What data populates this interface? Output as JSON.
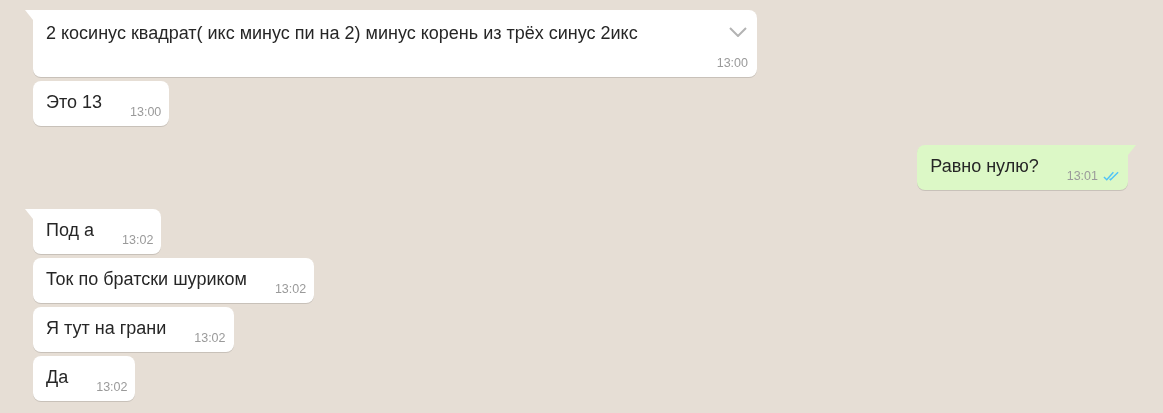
{
  "messages": [
    {
      "outgoing": false,
      "tail": true,
      "text": "2 косинус квадрат( икс минус пи на 2) минус корень из трёх синус 2икс",
      "time": "13:00",
      "time_below": true,
      "show_menu": true
    },
    {
      "outgoing": false,
      "tail": false,
      "text": "Это 13",
      "time": "13:00",
      "time_below": false,
      "show_menu": false
    },
    {
      "outgoing": true,
      "tail": true,
      "text": "Равно нулю?",
      "time": "13:01",
      "time_below": false,
      "show_menu": false,
      "read": true
    },
    {
      "outgoing": false,
      "tail": true,
      "text": "Под а",
      "time": "13:02",
      "time_below": false,
      "show_menu": false
    },
    {
      "outgoing": false,
      "tail": false,
      "text": "Ток по братски шуриком",
      "time": "13:02",
      "time_below": false,
      "show_menu": false
    },
    {
      "outgoing": false,
      "tail": false,
      "text": "Я тут на грани",
      "time": "13:02",
      "time_below": false,
      "show_menu": false
    },
    {
      "outgoing": false,
      "tail": false,
      "text": "Да",
      "time": "13:02",
      "time_below": false,
      "show_menu": false
    }
  ]
}
